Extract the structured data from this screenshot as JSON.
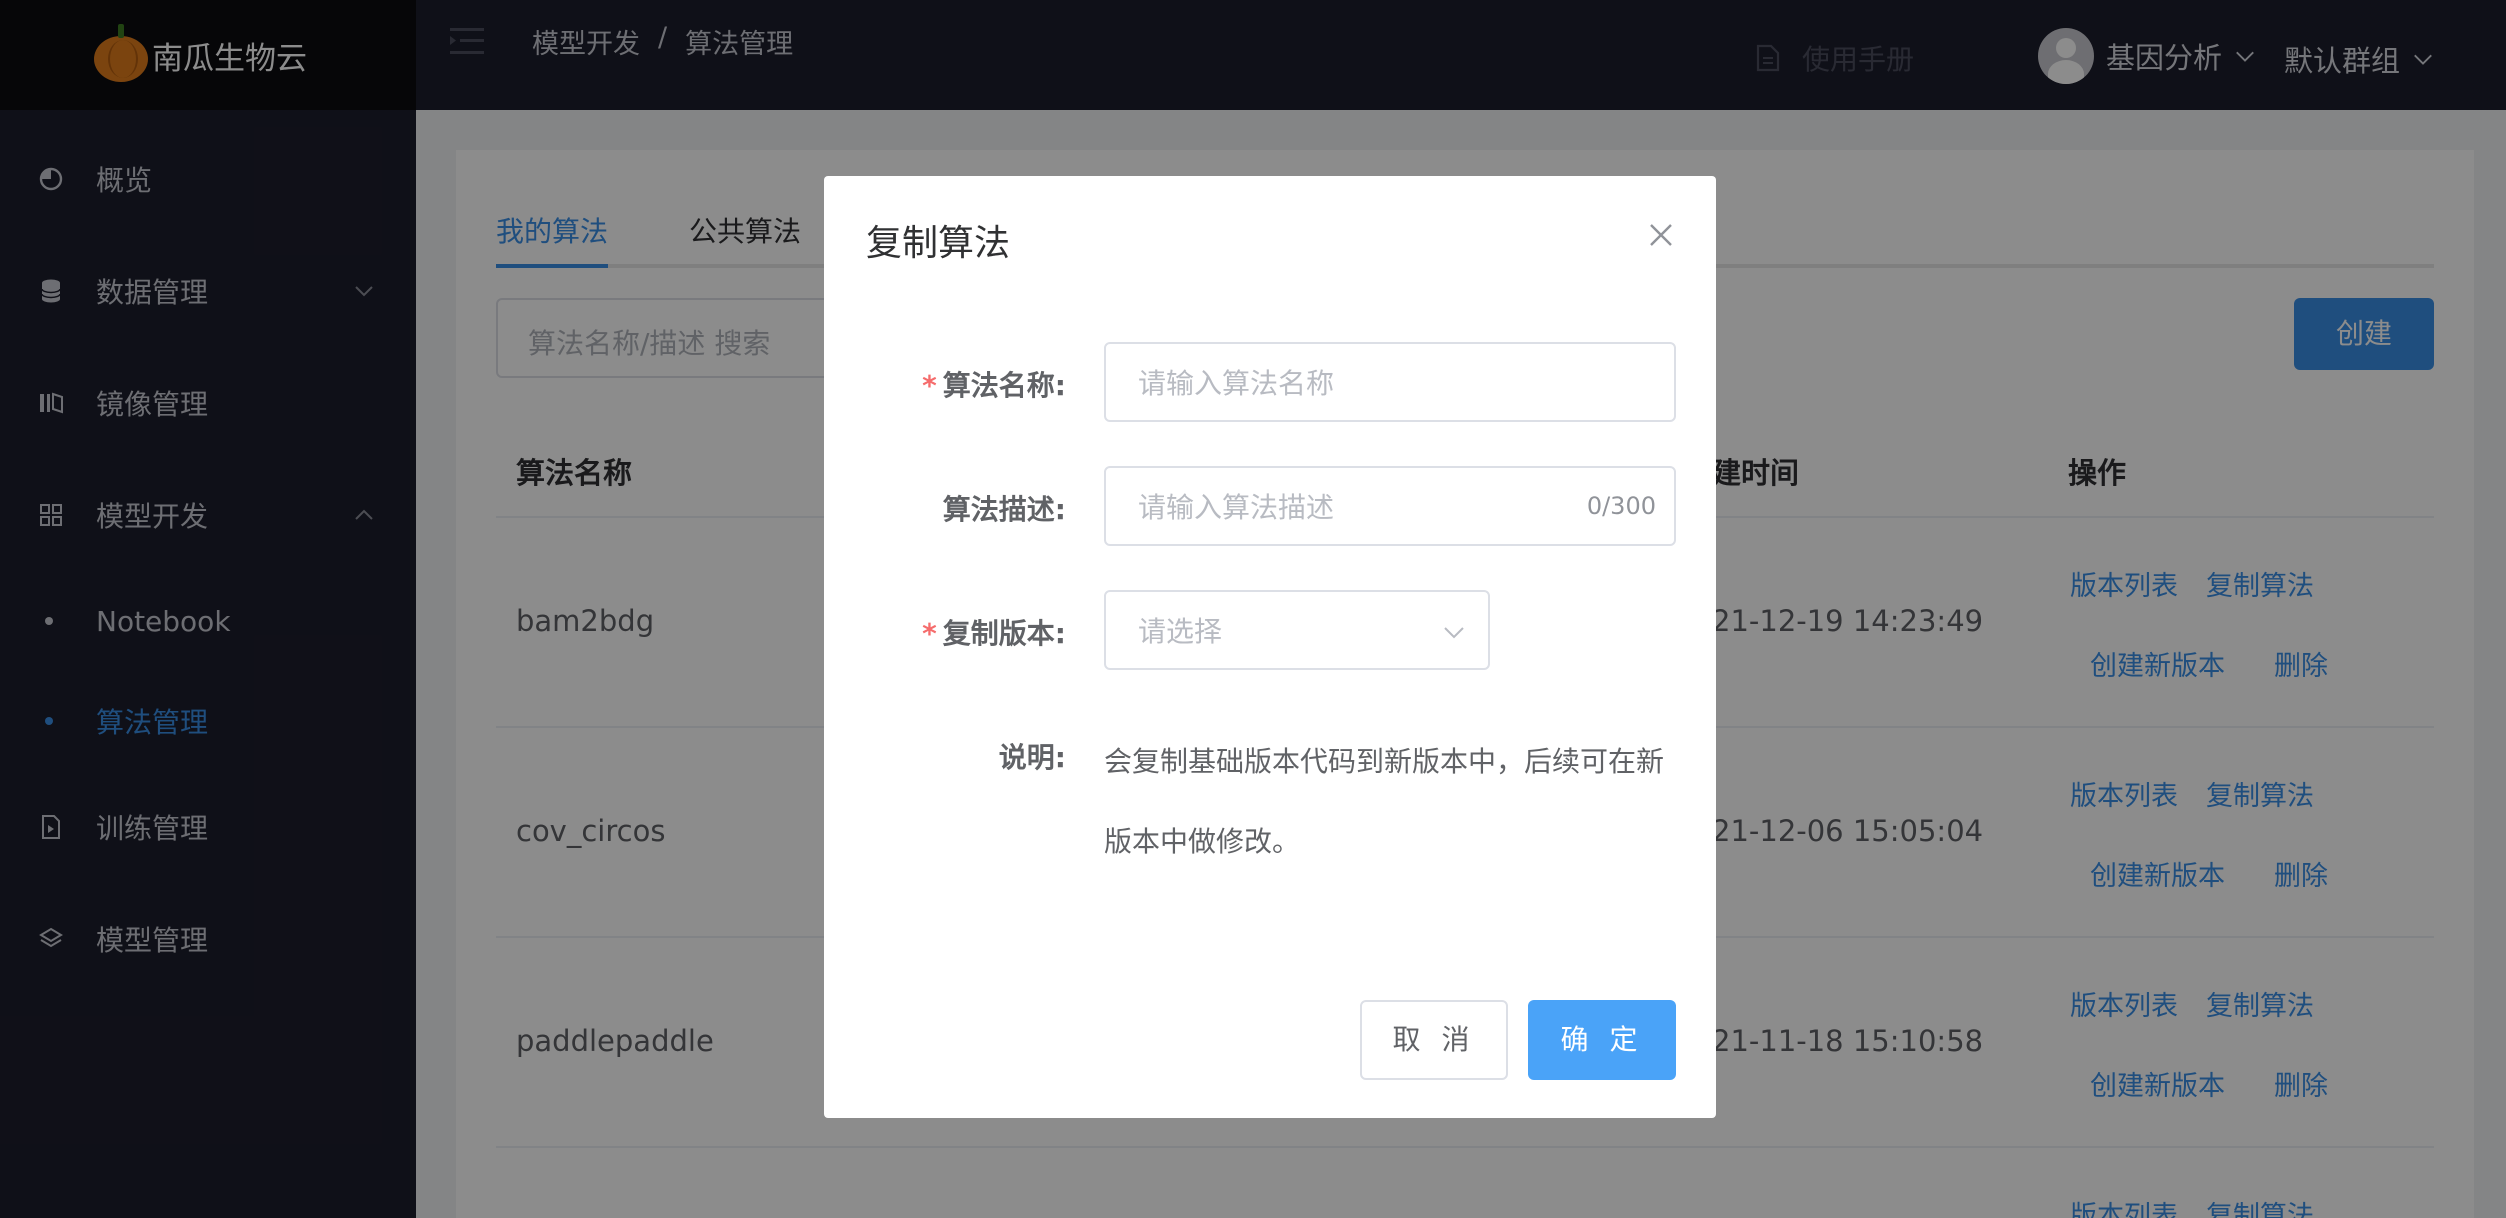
{
  "app": {
    "name": "南瓜生物云"
  },
  "sidebar": {
    "items": [
      {
        "label": "概览"
      },
      {
        "label": "数据管理"
      },
      {
        "label": "镜像管理"
      },
      {
        "label": "模型开发"
      },
      {
        "label": "Notebook"
      },
      {
        "label": "算法管理"
      },
      {
        "label": "训练管理"
      },
      {
        "label": "模型管理"
      }
    ]
  },
  "header": {
    "breadcrumb": [
      "模型开发",
      "/",
      "算法管理"
    ],
    "manual": "使用手册",
    "user": "基因分析",
    "group": "默认群组"
  },
  "main": {
    "tabs": [
      "我的算法",
      "公共算法"
    ],
    "search_placeholder": "算法名称/描述 搜索",
    "create_label": "创建",
    "columns": [
      "算法名称",
      "建时间",
      "操作"
    ],
    "rows": [
      {
        "name": "bam2bdg",
        "time": "21-12-19 14:23:49"
      },
      {
        "name": "cov_circos",
        "time": "21-12-06 15:05:04"
      },
      {
        "name": "paddlepaddle",
        "time": "21-11-18 15:10:58"
      }
    ],
    "ops": [
      "版本列表",
      "复制算法",
      "创建新版本",
      "删除"
    ]
  },
  "dialog": {
    "title": "复制算法",
    "fields": {
      "name_label": "算法名称:",
      "name_placeholder": "请输入算法名称",
      "desc_label": "算法描述:",
      "desc_placeholder": "请输入算法描述",
      "desc_counter": "0/300",
      "version_label": "复制版本:",
      "version_placeholder": "请选择",
      "note_label": "说明:",
      "note_text": "会复制基础版本代码到新版本中，后续可在新版本中做修改。"
    },
    "cancel_label": "取 消",
    "ok_label": "确 定"
  },
  "colors": {
    "accent": "#3a8ee6",
    "sidebar": "#1d1e2c",
    "required": "#f56c6c"
  }
}
